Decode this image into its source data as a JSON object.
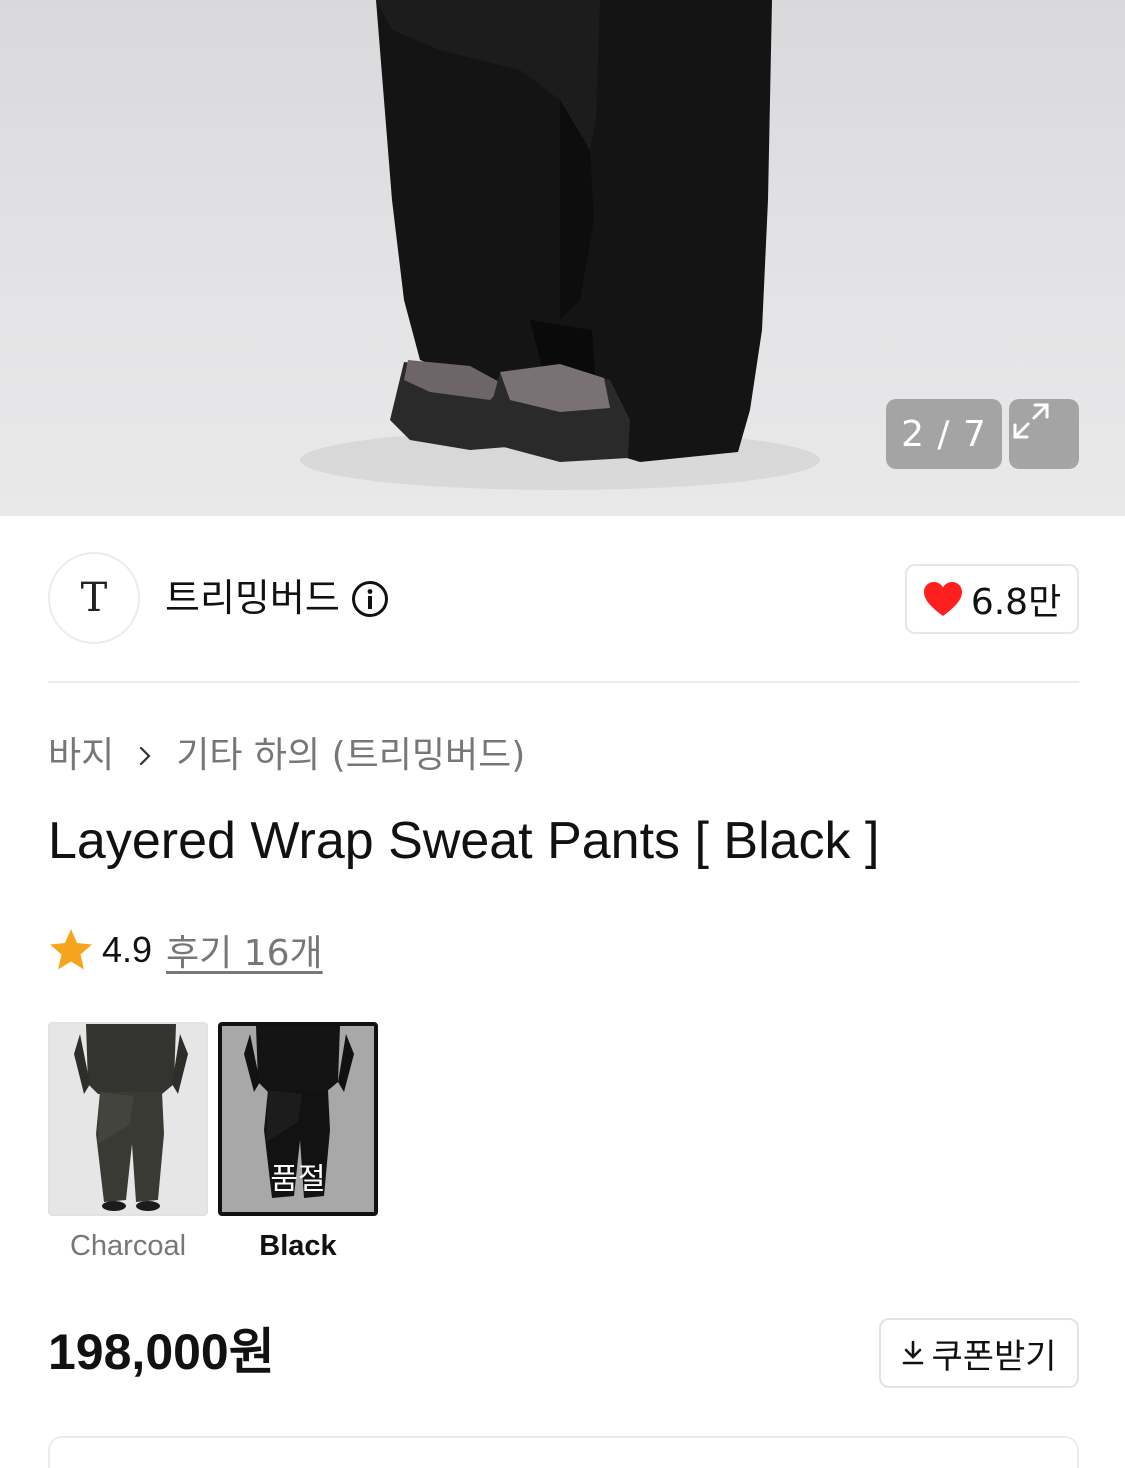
{
  "gallery": {
    "counter": "2 / 7",
    "image_icon": "product-photo-pants",
    "expand_icon": "expand-icon"
  },
  "brand": {
    "logo_text": "T",
    "name": "트리밍버드",
    "info_icon": "info-icon"
  },
  "like": {
    "icon": "heart-icon",
    "color": "#ff1f1f",
    "count": "6.8만"
  },
  "breadcrumb": {
    "level1": "바지",
    "separator_icon": "chevron-right-icon",
    "level2": "기타 하의 (트리밍버드)"
  },
  "product": {
    "title": "Layered Wrap Sweat Pants [ Black ]",
    "rating_icon": "star-icon",
    "rating_color": "#f7a41d",
    "rating": "4.9",
    "reviews": "후기 16개",
    "price": "198,000원"
  },
  "options": [
    {
      "label": "Charcoal",
      "selected": false,
      "badge": ""
    },
    {
      "label": "Black",
      "selected": true,
      "badge": "품절"
    }
  ],
  "coupon": {
    "icon": "download-icon",
    "label": "쿠폰받기"
  }
}
